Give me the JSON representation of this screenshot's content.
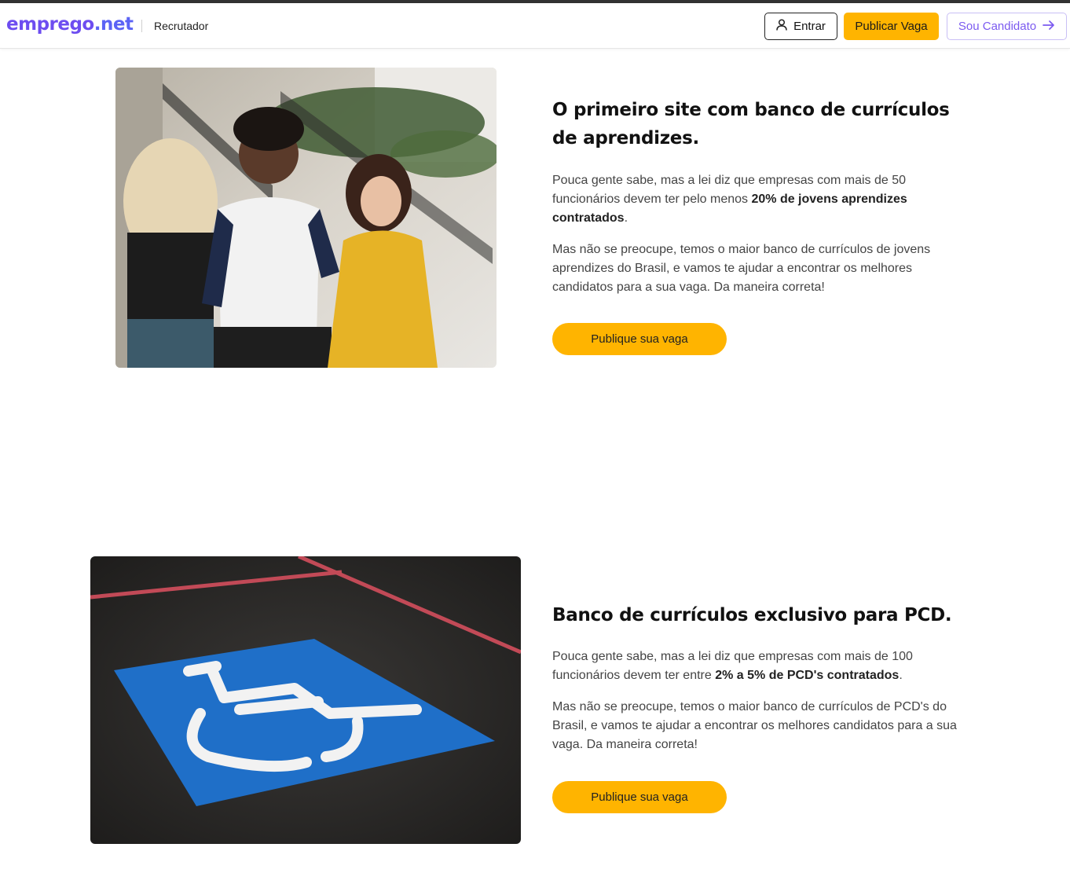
{
  "header": {
    "logo_main": "emprego",
    "logo_suffix": ".net",
    "section_label": "Recrutador",
    "login_label": "Entrar",
    "publish_label": "Publicar Vaga",
    "candidate_label": "Sou Candidato"
  },
  "section_apprentices": {
    "title": "O primeiro site com banco de currículos de aprendizes.",
    "para1_start": "Pouca gente sabe, mas a lei diz que empresas com mais de 50 funcionários devem ter pelo menos ",
    "para1_bold": "20% de jovens aprendizes contratados",
    "para1_end": ".",
    "para2": "Mas não se preocupe, temos o maior banco de currículos de jovens aprendizes do Brasil, e vamos te ajudar a encontrar os melhores candidatos para a sua vaga. Da maneira correta!",
    "cta_label": "Publique sua vaga"
  },
  "section_pcd": {
    "title": "Banco de currículos exclusivo para PCD.",
    "para1_start": "Pouca gente sabe, mas a lei diz que empresas com mais de 100 funcionários devem ter entre ",
    "para1_bold": "2% a 5% de PCD's contratados",
    "para1_end": ".",
    "para2": "Mas não se preocupe, temos o maior banco de currículos de PCD's do Brasil, e vamos te ajudar a encontrar os melhores candidatos para a sua vaga. Da maneira correta!",
    "cta_label": "Publique sua vaga"
  },
  "colors": {
    "brand": "#6d4df0",
    "accent": "#ffb400",
    "candidate_text": "#7b5af0"
  },
  "icons": {
    "login": "user-icon",
    "candidate": "arrow-right-icon"
  }
}
